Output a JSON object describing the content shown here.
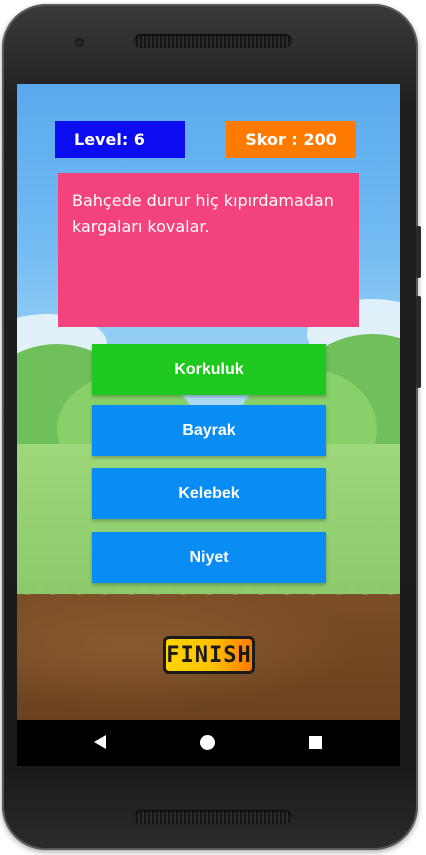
{
  "header": {
    "level_text": "Level: 6",
    "score_text": "Skor : 200"
  },
  "question": {
    "text": "Bahçede durur hiç kıpırdamadan kargaları kovalar."
  },
  "answers": [
    {
      "label": "Korkuluk",
      "color": "#1ec81e"
    },
    {
      "label": "Bayrak",
      "color": "#0a8cf5"
    },
    {
      "label": "Kelebek",
      "color": "#0a8cf5"
    },
    {
      "label": "Niyet",
      "color": "#0a8cf5"
    }
  ],
  "finish": {
    "label": "FINISH"
  },
  "colors": {
    "level_bg": "#0c0cf0",
    "score_bg": "#ff7a00",
    "question_bg": "#f4427c",
    "correct": "#1ec81e",
    "option": "#0a8cf5"
  },
  "navbar": {
    "icons": [
      "back-icon",
      "home-icon",
      "recents-icon"
    ]
  }
}
